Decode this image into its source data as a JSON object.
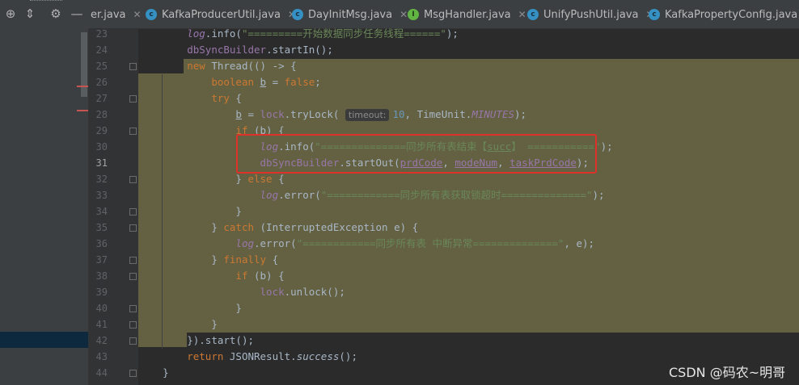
{
  "tabs": [
    {
      "label": "er.java",
      "icon": "none"
    },
    {
      "label": "KafkaProducerUtil.java",
      "icon": "class-icon"
    },
    {
      "label": "DayInitMsg.java",
      "icon": "class-icon"
    },
    {
      "label": "MsgHandler.java",
      "icon": "interface-icon"
    },
    {
      "label": "UnifyPushUtil.java",
      "icon": "class-icon"
    },
    {
      "label": "KafkaPropertyConfig.java",
      "icon": "class-icon"
    }
  ],
  "tab_close": "✕",
  "icon_letters": {
    "class": "c",
    "interface": "I"
  },
  "line_numbers": [
    "23",
    "24",
    "25",
    "26",
    "27",
    "28",
    "29",
    "30",
    "31",
    "32",
    "33",
    "34",
    "35",
    "36",
    "37",
    "38",
    "39",
    "40",
    "41",
    "42",
    "43",
    "44"
  ],
  "code": {
    "l23_a": "log",
    "l23_b": ".info(",
    "l23_c": "\"=========开始数据同步任务线程======\"",
    "l23_d": ");",
    "l24_a": "dbSyncBuilder",
    "l24_b": ".startIn();",
    "l25_a": "new ",
    "l25_b": "Thread(() -> {",
    "l26_a": "boolean ",
    "l26_b": "b",
    "l26_c": " = ",
    "l26_d": "false",
    "l26_e": ";",
    "l27_a": "try ",
    "l27_b": "{",
    "l28_a": "b",
    "l28_b": " = ",
    "l28_c": "lock",
    "l28_d": ".tryLock( ",
    "l28_hint": "timeout:",
    "l28_e": "10",
    "l28_f": ", TimeUnit.",
    "l28_g": "MINUTES",
    "l28_h": ");",
    "l29_a": "if ",
    "l29_b": "(b) {",
    "l30_a": "log",
    "l30_b": ".info(",
    "l30_c": "\"==============同步所有表结束【",
    "l30_d": "succ",
    "l30_e": "】 ===========\"",
    "l30_f": ");",
    "l31_a": "dbSyncBuilder",
    "l31_b": ".startOut(",
    "l31_c": "prdCode",
    "l31_d": ", ",
    "l31_e": "modeNum",
    "l31_f": ", ",
    "l31_g": "taskPrdCode",
    "l31_h": ");",
    "l32_a": "} ",
    "l32_b": "else ",
    "l32_c": "{",
    "l33_a": "log",
    "l33_b": ".error(",
    "l33_c": "\"============同步所有表获取锁超时==============\"",
    "l33_d": ");",
    "l34_a": "}",
    "l35_a": "} ",
    "l35_b": "catch ",
    "l35_c": "(InterruptedException e) {",
    "l36_a": "log",
    "l36_b": ".error(",
    "l36_c": "\"============同步所有表 中断异常==============\"",
    "l36_d": ", e);",
    "l37_a": "} ",
    "l37_b": "finally ",
    "l37_c": "{",
    "l38_a": "if ",
    "l38_b": "(b) {",
    "l39_a": "lock",
    "l39_b": ".unlock();",
    "l40_a": "}",
    "l41_a": "}",
    "l42_a": "})",
    "l42_b": ".start();",
    "l43_a": "return ",
    "l43_b": "JSONResult.",
    "l43_c": "success",
    "l43_d": "();",
    "l44_a": "}"
  },
  "watermark": "CSDN @码农~明哥",
  "colors": {
    "keyword": "#cc7832",
    "field": "#9876aa",
    "string": "#6a8759",
    "number": "#6897bb",
    "highlight": "#636141",
    "annotation_box": "#e0302a"
  }
}
